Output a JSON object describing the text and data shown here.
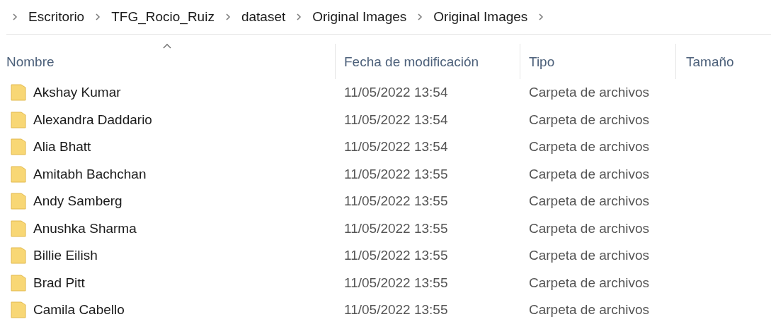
{
  "breadcrumb": [
    "Escritorio",
    "TFG_Rocio_Ruiz",
    "dataset",
    "Original Images",
    "Original Images"
  ],
  "columns": [
    {
      "label": "Nombre",
      "sorted": true
    },
    {
      "label": "Fecha de modificación",
      "sorted": false
    },
    {
      "label": "Tipo",
      "sorted": false
    },
    {
      "label": "Tamaño",
      "sorted": false
    }
  ],
  "rows": [
    {
      "name": "Akshay Kumar",
      "date": "11/05/2022 13:54",
      "type": "Carpeta de archivos"
    },
    {
      "name": "Alexandra Daddario",
      "date": "11/05/2022 13:54",
      "type": "Carpeta de archivos"
    },
    {
      "name": "Alia Bhatt",
      "date": "11/05/2022 13:54",
      "type": "Carpeta de archivos"
    },
    {
      "name": "Amitabh Bachchan",
      "date": "11/05/2022 13:55",
      "type": "Carpeta de archivos"
    },
    {
      "name": "Andy Samberg",
      "date": "11/05/2022 13:55",
      "type": "Carpeta de archivos"
    },
    {
      "name": "Anushka Sharma",
      "date": "11/05/2022 13:55",
      "type": "Carpeta de archivos"
    },
    {
      "name": "Billie Eilish",
      "date": "11/05/2022 13:55",
      "type": "Carpeta de archivos"
    },
    {
      "name": "Brad Pitt",
      "date": "11/05/2022 13:55",
      "type": "Carpeta de archivos"
    },
    {
      "name": "Camila Cabello",
      "date": "11/05/2022 13:55",
      "type": "Carpeta de archivos"
    }
  ]
}
